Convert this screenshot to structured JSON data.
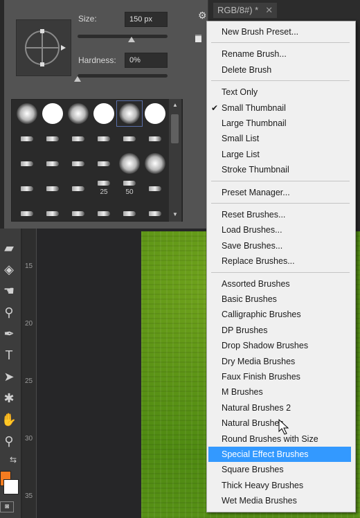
{
  "document_tab": {
    "title": "RGB/8#) *",
    "close_icon": "close-icon"
  },
  "brush_panel": {
    "size_label": "Size:",
    "size_value": "150 px",
    "size_slider_fraction": 0.6,
    "hardness_label": "Hardness:",
    "hardness_value": "0%",
    "hardness_slider_fraction": 0.0,
    "brush_grid": {
      "rows": [
        [
          "soft",
          "hard",
          "soft",
          "hard",
          "soft",
          "hard"
        ],
        [
          "tip",
          "tip",
          "tip",
          "tip",
          "tip",
          "tip"
        ],
        [
          "tip",
          "tip",
          "tip",
          "tip",
          "soft",
          "soft"
        ],
        [
          "tip",
          "tip",
          "tip",
          "tip",
          "tip",
          "tip"
        ],
        [
          "tip",
          "tip",
          "tip",
          "tip",
          "tip",
          "tip"
        ]
      ],
      "labels": {
        "3.3": "25",
        "3.4": "50"
      },
      "selected": "0.4"
    }
  },
  "ruler_left": {
    "labels": [
      "15",
      "20",
      "25",
      "30",
      "35"
    ]
  },
  "colors": {
    "foreground": "#f47c20",
    "background": "#ffffff",
    "menu_highlight": "#3399ff"
  },
  "menu": {
    "groups": [
      [
        {
          "label": "New Brush Preset..."
        }
      ],
      [
        {
          "label": "Rename Brush..."
        },
        {
          "label": "Delete Brush"
        }
      ],
      [
        {
          "label": "Text Only"
        },
        {
          "label": "Small Thumbnail",
          "checked": true
        },
        {
          "label": "Large Thumbnail"
        },
        {
          "label": "Small List"
        },
        {
          "label": "Large List"
        },
        {
          "label": "Stroke Thumbnail"
        }
      ],
      [
        {
          "label": "Preset Manager..."
        }
      ],
      [
        {
          "label": "Reset Brushes..."
        },
        {
          "label": "Load Brushes..."
        },
        {
          "label": "Save Brushes..."
        },
        {
          "label": "Replace Brushes..."
        }
      ],
      [
        {
          "label": "Assorted Brushes"
        },
        {
          "label": "Basic Brushes"
        },
        {
          "label": "Calligraphic Brushes"
        },
        {
          "label": "DP Brushes"
        },
        {
          "label": "Drop Shadow Brushes"
        },
        {
          "label": "Dry Media Brushes"
        },
        {
          "label": "Faux Finish Brushes"
        },
        {
          "label": "M Brushes"
        },
        {
          "label": "Natural Brushes 2"
        },
        {
          "label": "Natural Brushes"
        },
        {
          "label": "Round Brushes with Size"
        },
        {
          "label": "Special Effect Brushes",
          "highlighted": true
        },
        {
          "label": "Square Brushes"
        },
        {
          "label": "Thick Heavy Brushes"
        },
        {
          "label": "Wet Media Brushes"
        }
      ]
    ]
  },
  "tools": [
    {
      "name": "eraser-icon",
      "glyph": "▰"
    },
    {
      "name": "paint-bucket-icon",
      "glyph": "◈"
    },
    {
      "name": "smudge-icon",
      "glyph": "☚"
    },
    {
      "name": "dodge-icon",
      "glyph": "⚲"
    },
    {
      "name": "pen-icon",
      "glyph": "✒"
    },
    {
      "name": "type-icon",
      "glyph": "T"
    },
    {
      "name": "path-select-icon",
      "glyph": "➤"
    },
    {
      "name": "shape-icon",
      "glyph": "✱"
    },
    {
      "name": "hand-icon",
      "glyph": "✋"
    },
    {
      "name": "zoom-icon",
      "glyph": "⚲"
    }
  ]
}
